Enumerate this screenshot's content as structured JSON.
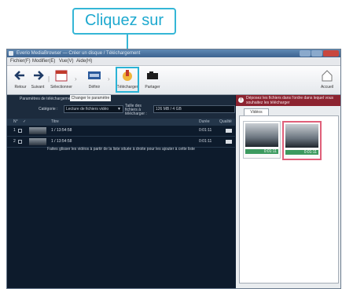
{
  "callout": {
    "text": "Cliquez sur"
  },
  "window": {
    "title": "Everio MediaBrowser — Créer un disque / Téléchargement",
    "menu": [
      "Fichier(F)",
      "Modifier(E)",
      "Vue(V)",
      "Aide(H)"
    ]
  },
  "toolbar": {
    "buttons": [
      {
        "label": "Retour",
        "icon": "back-arrow-icon"
      },
      {
        "label": "Suivant",
        "icon": "forward-arrow-icon"
      },
      {
        "label": "Sélectionner",
        "icon": "calendar-icon"
      },
      {
        "label": "Définir",
        "icon": "media-icon"
      },
      {
        "label": "Télécharger",
        "icon": "upload-icon"
      },
      {
        "label": "Partager",
        "icon": "camera-icon"
      }
    ],
    "home_label": "Accueil"
  },
  "options": {
    "popup": "Changer le paramètre",
    "settings_label": "Paramètres de téléchargement",
    "category_label": "Catégorie :",
    "category_value": "Lecture de fichiers vidéo",
    "size_label": "Taille des fichiers à télécharger :",
    "size_value": "126 MB / 4 GB"
  },
  "table": {
    "headers": [
      "N°",
      "✓",
      "Titre",
      "Durée",
      "Qualité"
    ],
    "rows": [
      {
        "no": "1",
        "title": "1 / 13:54:58",
        "duration": "0:01:11",
        "quality": "HD"
      },
      {
        "no": "2",
        "title": "1 / 13:54:58",
        "duration": "0:01:11",
        "quality": "HD"
      }
    ],
    "hint": "Faites glisser les vidéos à partir de la liste située à droite pour les ajouter à cette liste"
  },
  "right": {
    "warning": "Déposez les fichiers dans l'ordre dans lequel vous souhaitez les télécharger",
    "tab": "Vidéos",
    "cards": [
      {
        "time": "0:01:11",
        "selected": false
      },
      {
        "time": "0:01:11",
        "selected": true
      }
    ]
  }
}
